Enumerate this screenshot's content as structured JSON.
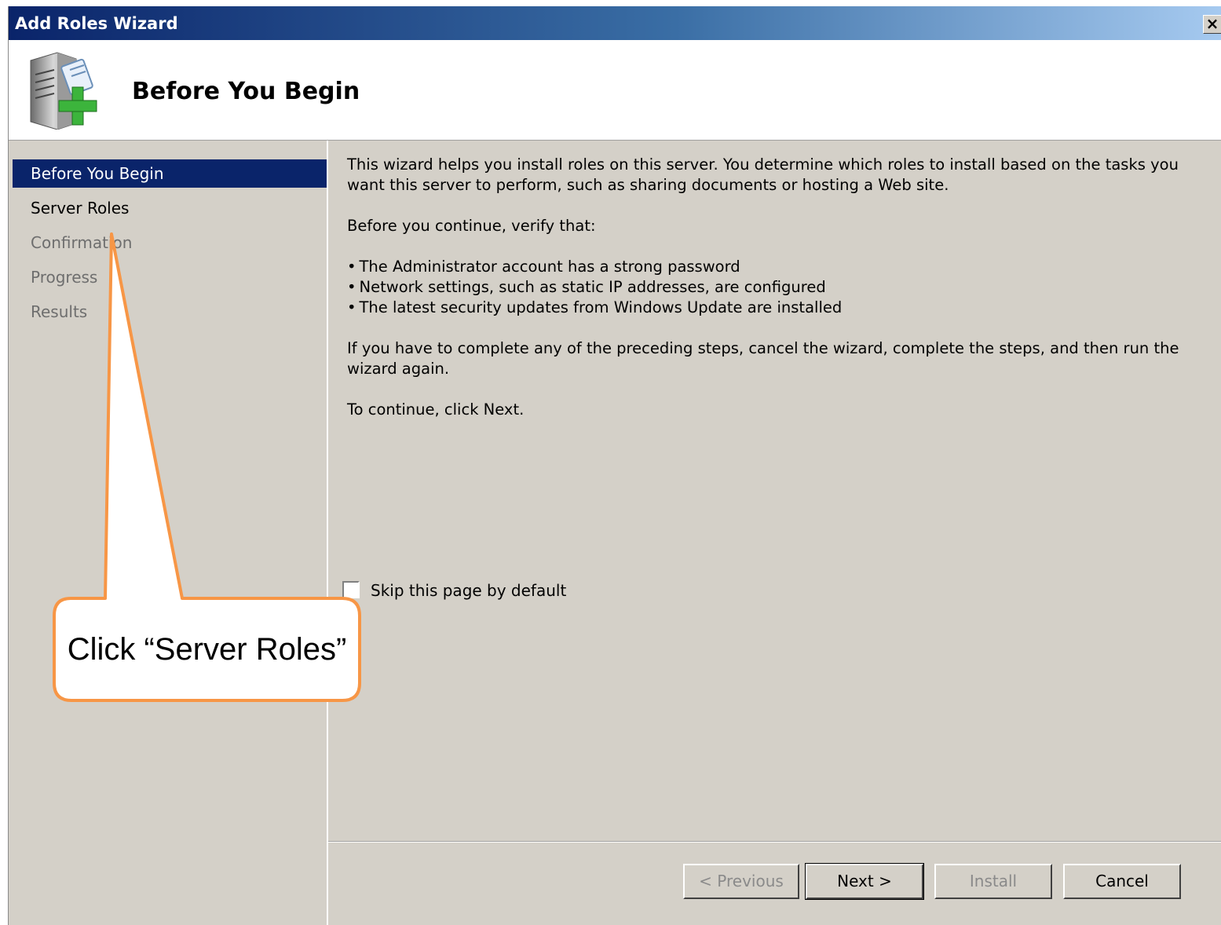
{
  "window": {
    "title": "Add Roles Wizard",
    "close_label": "×"
  },
  "header": {
    "title": "Before You Begin",
    "icon": "server-add-icon"
  },
  "nav": {
    "items": [
      {
        "label": "Before You Begin",
        "state": "selected"
      },
      {
        "label": "Server Roles",
        "state": "enabled"
      },
      {
        "label": "Confirmation",
        "state": "disabled"
      },
      {
        "label": "Progress",
        "state": "disabled"
      },
      {
        "label": "Results",
        "state": "disabled"
      }
    ]
  },
  "content": {
    "intro": "This wizard helps you install roles on this server. You determine which roles to install based on the tasks you want this server to perform, such as sharing documents or hosting a Web site.",
    "verify_heading": "Before you continue, verify that:",
    "bullets": [
      "The Administrator account has a strong password",
      "Network settings, such as static IP addresses, are configured",
      "The latest security updates from Windows Update are installed"
    ],
    "preceding": "If you have to complete any of the preceding steps, cancel the wizard, complete the steps, and then run the wizard again.",
    "continue": "To continue, click Next."
  },
  "skip": {
    "label": "Skip this page by default",
    "checked": false
  },
  "buttons": {
    "previous": "< Previous",
    "next": "Next >",
    "install": "Install",
    "cancel": "Cancel"
  },
  "callout": {
    "text": "Click “Server Roles”",
    "color": "#f79646"
  },
  "colors": {
    "titlebar_start": "#0a246a",
    "selection": "#0a246a",
    "dialog_bg": "#d4d0c8"
  }
}
